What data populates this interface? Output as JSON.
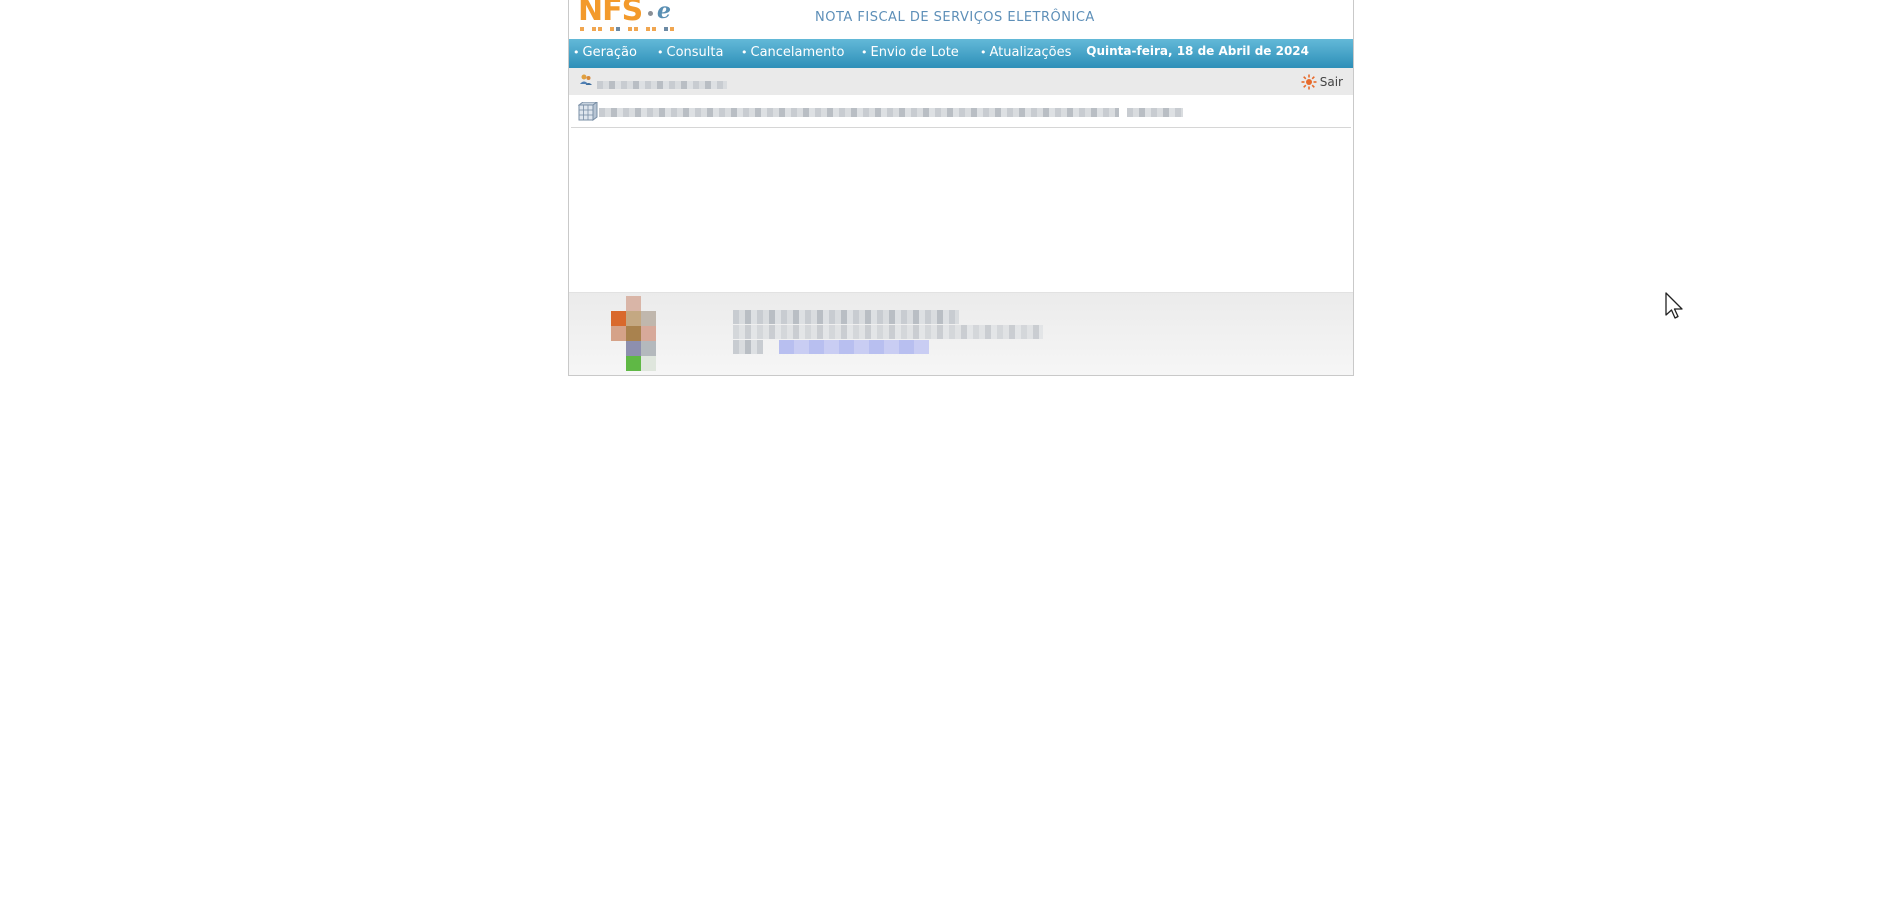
{
  "header": {
    "logo_text": "NFS",
    "logo_suffix": "e",
    "title": "NOTA FISCAL DE SERVIÇOS ELETRÔNICA"
  },
  "menu": {
    "items": [
      {
        "label": "Geração"
      },
      {
        "label": "Consulta"
      },
      {
        "label": "Cancelamento"
      },
      {
        "label": "Envio de Lote"
      },
      {
        "label": "Atualizações"
      }
    ],
    "date": "Quinta-feira, 18 de Abril de 2024"
  },
  "userbar": {
    "logout_label": "Sair"
  },
  "colors": {
    "accent": "#2d8fb8",
    "logo_orange": "#f39a2b",
    "title_blue": "#5d8fb8"
  },
  "icons": {
    "user": "users-icon",
    "logout": "logout-sun-icon",
    "grid": "grid-cube-icon",
    "cursor": "mouse-cursor-icon"
  }
}
